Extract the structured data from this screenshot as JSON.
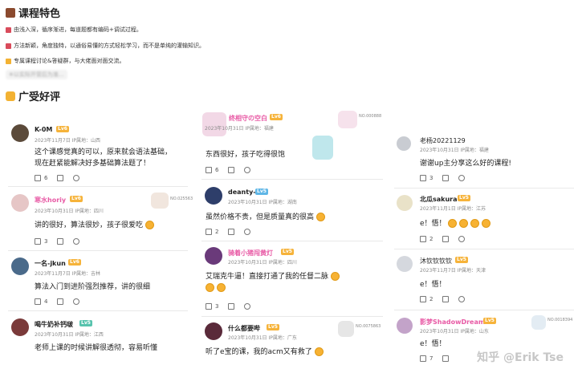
{
  "features": {
    "title": "课程特色",
    "items": [
      "由浅入深，循序渐进，每道题都有编码+调试过程。",
      "方法新颖，角度独特，以通俗易懂的方式轻松学习，而不是单纯的灌输知识。",
      "专属课程讨论&答疑群，与大佬面对面交流。"
    ],
    "blurred_note": "※以实际开营后为准..."
  },
  "reviews": {
    "title": "广受好评",
    "col1": [
      {
        "user": "K-0M",
        "level": "Lv6",
        "date": "2023年11月7日",
        "ip": "IP属地：山西",
        "text1": "这个课感觉真的可以，原来就会语法基础，",
        "text2": "现在赶紧能解决好多基础算法题了！",
        "likes": "6"
      },
      {
        "user": "寒水horiy",
        "level": "Lv6",
        "date": "2023年10月31日",
        "ip": "IP属地：四川",
        "text1": "讲的很好，算法很妙，孩子很爱吃",
        "text2": "",
        "likes": "3",
        "badge": "NO.025563"
      },
      {
        "user": "一名-jkun",
        "level": "Lv6",
        "date": "2023年11月7日",
        "ip": "IP属地：吉林",
        "text1": "算法入门到进阶强烈推荐，讲的很细",
        "text2": "",
        "likes": "4"
      },
      {
        "user": "喝牛奶补钙啵",
        "level": "Lv5",
        "date": "2023年10月31日",
        "ip": "IP属地：江西",
        "text1": "老师上课的时候讲解很透彻，容易听懂",
        "text2": "",
        "likes": ""
      }
    ],
    "col2": [
      {
        "user": "终相守の空白",
        "level": "Lv6",
        "date": "2023年10月31日",
        "ip": "IP属地：福建",
        "text1": "东西很好，孩子吃得很饱",
        "text2": "",
        "likes": "6",
        "badge": "NO.000888"
      },
      {
        "user": "deanty-",
        "level": "Lv5",
        "date": "2023年10月31日",
        "ip": "IP属地：湖南",
        "text1": "虽然价格不贵，但是质量真的很高",
        "text2": "",
        "likes": "2"
      },
      {
        "user": "骑着小猪闯黄灯",
        "level": "Lv5",
        "date": "2023年10月31日",
        "ip": "IP属地：四川",
        "text1": "艾瑞克牛逼！直接打通了我的任督二脉",
        "text2": "",
        "likes": "3"
      },
      {
        "user": "什么都要哔",
        "level": "Lv5",
        "date": "2023年10月31日",
        "ip": "IP属地：广东",
        "text1": "听了e宝的课，我的acm又有救了",
        "text2": "",
        "likes": "",
        "badge": "NO.0075863"
      }
    ],
    "col3": [
      {
        "user": "老杨20221129",
        "level": "Lv5",
        "date": "2023年10月31日",
        "ip": "IP属地：福建",
        "text1": "谢谢up主分享这么好的课程!",
        "text2": "",
        "likes": "3"
      },
      {
        "user": "北瓜sakura",
        "level": "Lv5",
        "date": "2023年11月1日",
        "ip": "IP属地：江苏",
        "text1": "e！悟！",
        "text2": "",
        "likes": "2"
      },
      {
        "user": "沐钦钦钦钦",
        "level": "Lv5",
        "date": "2023年11月7日",
        "ip": "IP属地：天津",
        "text1": "e！悟！",
        "text2": "",
        "likes": "2"
      },
      {
        "user": "影梦ShadowDream",
        "level": "Lv5",
        "date": "2023年10月31日",
        "ip": "IP属地：山东",
        "text1": "e！悟！",
        "text2": "",
        "likes": "7",
        "badge": "NO.0018394"
      }
    ]
  },
  "watermark": "知乎 @Erik Tse",
  "colors": {
    "pink_name": "#e85aa5",
    "level": "#f6b33a",
    "accent": "#e8b23a"
  }
}
